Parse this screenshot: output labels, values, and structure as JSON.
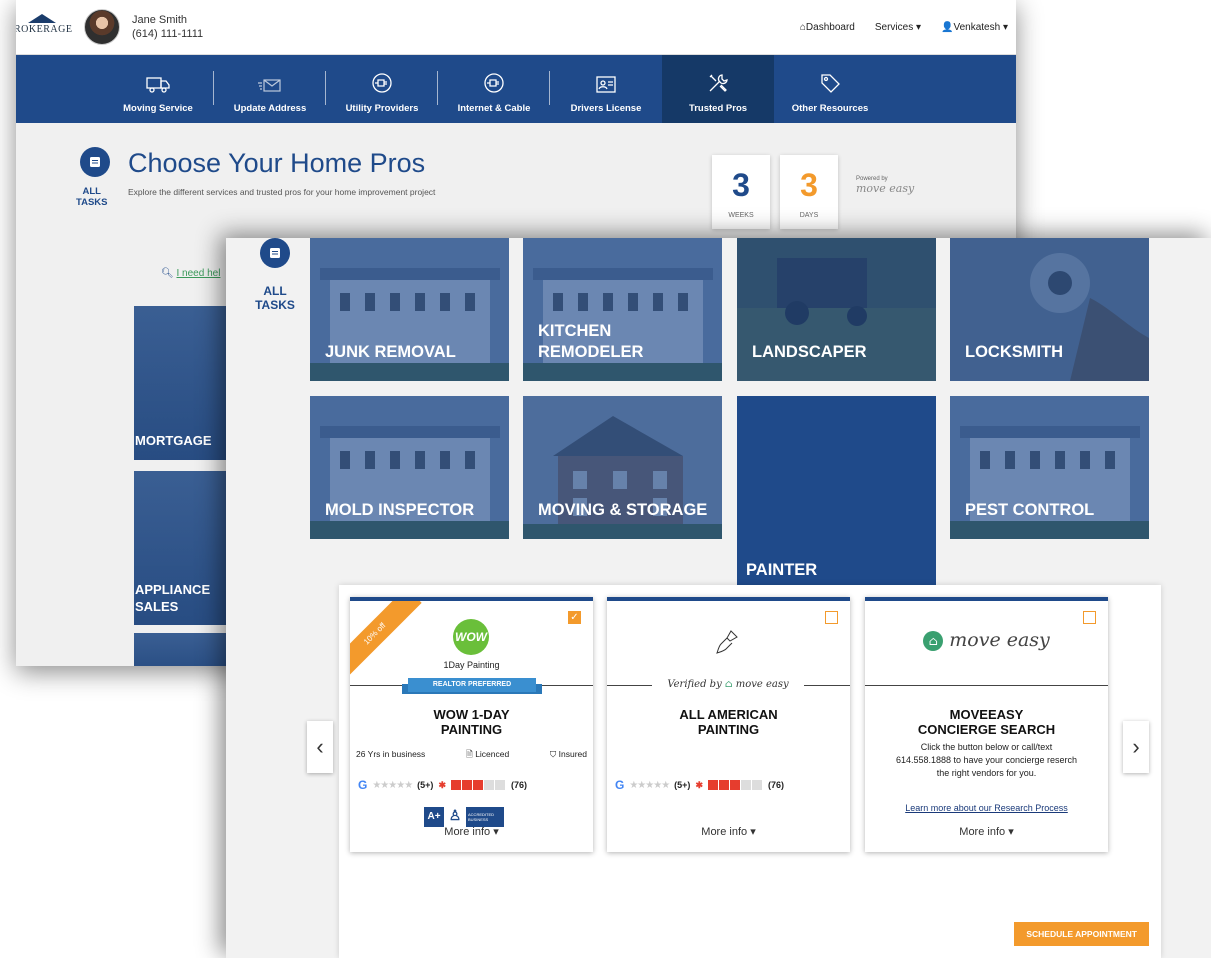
{
  "back": {
    "logo": "ROKERAGE",
    "agent_name": "Jane Smith",
    "agent_phone": "(614) 111-1111",
    "top_links": [
      "Dashboard",
      "Services",
      "Venkatesh"
    ],
    "nav": [
      {
        "label": "Moving Service",
        "icon": "truck-icon"
      },
      {
        "label": "Update Address",
        "icon": "envelope-icon"
      },
      {
        "label": "Utility Providers",
        "icon": "plug-icon"
      },
      {
        "label": "Internet & Cable",
        "icon": "plug-icon"
      },
      {
        "label": "Drivers License",
        "icon": "id-card-icon"
      },
      {
        "label": "Trusted Pros",
        "icon": "tools-icon"
      },
      {
        "label": "Other Resources",
        "icon": "tag-icon"
      }
    ],
    "active_nav": "Trusted Pros",
    "all_tasks_label": [
      "ALL",
      "TASKS"
    ],
    "title": "Choose Your Home Pros",
    "subtitle": "Explore the different services and trusted pros for your home improvement project",
    "countdown": [
      {
        "value": "3",
        "unit": "WEEKS"
      },
      {
        "value": "3",
        "unit": "DAYS"
      }
    ],
    "powered_by": "Powered by",
    "powered_brand": "move easy",
    "search_link": "I need hel",
    "tiles": [
      "MORTGAGE",
      "APPLIANCE SALES"
    ]
  },
  "front": {
    "all_tasks_label": [
      "ALL",
      "TASKS"
    ],
    "tiles": [
      {
        "label": "JUNK REMOVAL",
        "lines": [
          "JUNK REMOVAL"
        ]
      },
      {
        "label": "KITCHEN REMODELER",
        "lines": [
          "KITCHEN",
          "REMODELER"
        ]
      },
      {
        "label": "LANDSCAPER",
        "lines": [
          "LANDSCAPER"
        ]
      },
      {
        "label": "LOCKSMITH",
        "lines": [
          "LOCKSMITH"
        ]
      },
      {
        "label": "MOLD INSPECTOR",
        "lines": [
          "MOLD INSPECTOR"
        ]
      },
      {
        "label": "MOVING & STORAGE",
        "lines": [
          "MOVING & STORAGE"
        ]
      },
      {
        "label": "PAINTER",
        "lines": [
          "PAINTER"
        ]
      },
      {
        "label": "PEST CONTROL",
        "lines": [
          "PEST CONTROL"
        ]
      }
    ],
    "active_tile": "PAINTER",
    "cards": [
      {
        "ribbon": "10% off",
        "logo_text": "WOW",
        "logo_caption": "1Day Painting",
        "banner": "REALTOR PREFERRED",
        "title_lines": [
          "WOW 1-DAY",
          "PAINTING"
        ],
        "years": "26 Yrs in business",
        "licensed": "Licenced",
        "insured": "Insured",
        "google_count": "(5+)",
        "yelp_count": "(76)",
        "badges": [
          "A+",
          "ACCREDITED BUSINESS"
        ],
        "more_info": "More info",
        "checked": true
      },
      {
        "verified_prefix": "Verified by",
        "verified_brand": "move easy",
        "title_lines": [
          "ALL AMERICAN",
          "PAINTING"
        ],
        "google_count": "(5+)",
        "yelp_count": "(76)",
        "more_info": "More info",
        "checked": false
      },
      {
        "brand": "move easy",
        "title_lines": [
          "MOVEEASY",
          "CONCIERGE SEARCH"
        ],
        "desc_lines": [
          "Click the button below or call/text",
          "614.558.1888 to have your concierge reserch",
          "the right vendors for you."
        ],
        "link": "Learn more about our Research Process",
        "more_info": "More info",
        "checked": false
      }
    ],
    "schedule_button": "SCHEDULE APPOINTMENT"
  },
  "colors": {
    "navy": "#1f4a8a",
    "orange": "#f39a2c",
    "yelp": "#e63d2e"
  }
}
